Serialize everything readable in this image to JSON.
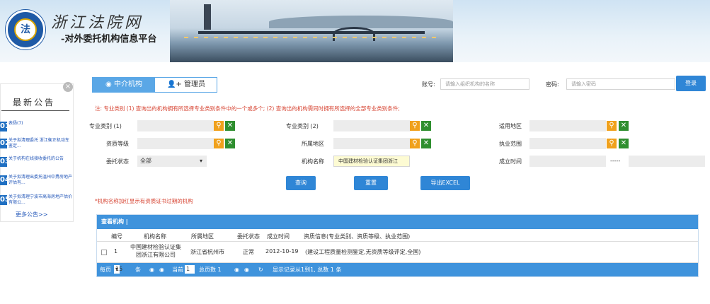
{
  "header": {
    "title": "浙江法院网",
    "subtitle": "-对外委托机构信息平台"
  },
  "notices": {
    "title": "最新公告",
    "items": [
      {
        "num": "01",
        "text": "表扬(7)"
      },
      {
        "num": "02",
        "text": "关于拟清理委托 浙江衡正机动车鉴定..."
      },
      {
        "num": "03",
        "text": "关于机构在线接收委托的公告"
      },
      {
        "num": "04",
        "text": "关于拟清理出委托温州中勇房地产评估有..."
      },
      {
        "num": "05",
        "text": "关于拟清理宁波市高海房地产估价有限公..."
      }
    ],
    "more": "更多公告>>"
  },
  "tabs": {
    "agency": "中介机构",
    "admin": "管理员"
  },
  "login": {
    "account_label": "账号:",
    "account_placeholder": "请输入组织机构的名称",
    "password_label": "密码:",
    "password_placeholder": "请输入密码",
    "button": "登录"
  },
  "note": "注: 专业类别 (1) 查询出的机构拥有所选择专业类别条件中的一个或多个;  (2) 查询出的机构需同时拥有所选择的全部专业类别条件;",
  "form": {
    "cat1": "专业类别 (1)",
    "cat2": "专业类别 (2)",
    "region_apply": "适用地区",
    "level": "资质等级",
    "region": "所属地区",
    "scope": "执业范围",
    "status": "委托状态",
    "status_value": "全部",
    "name": "机构名称",
    "name_value": "中国建材检验认证集团浙江",
    "founded": "成立时间",
    "date_sep": "-----"
  },
  "buttons": {
    "query": "查询",
    "reset": "重置",
    "export": "导出EXCEL"
  },
  "warning": "*机构名称加红显示有资质证书过期的机构",
  "table": {
    "caption": "查看机构",
    "columns": [
      "编号",
      "机构名称",
      "所属地区",
      "委托状态",
      "成立时间",
      "资质信息(专业类别、资质等级、执业范围)"
    ],
    "rows": [
      {
        "no": "1",
        "name_l1": "中国建材检验认证集",
        "name_l2": "团浙江有限公司",
        "region": "浙江省杭州市",
        "status": "正常",
        "date": "2012-10-19",
        "info": "(建设工程质量检测鉴定,无资质等级评定,全国)"
      }
    ]
  },
  "pager": {
    "per_page_prefix": "每页",
    "per_page": "15",
    "per_page_suffix": "条",
    "current_prefix": "当前",
    "page": "1",
    "total_pages": "总页数 1",
    "summary": "显示记录从1到1, 总数 1 条"
  }
}
